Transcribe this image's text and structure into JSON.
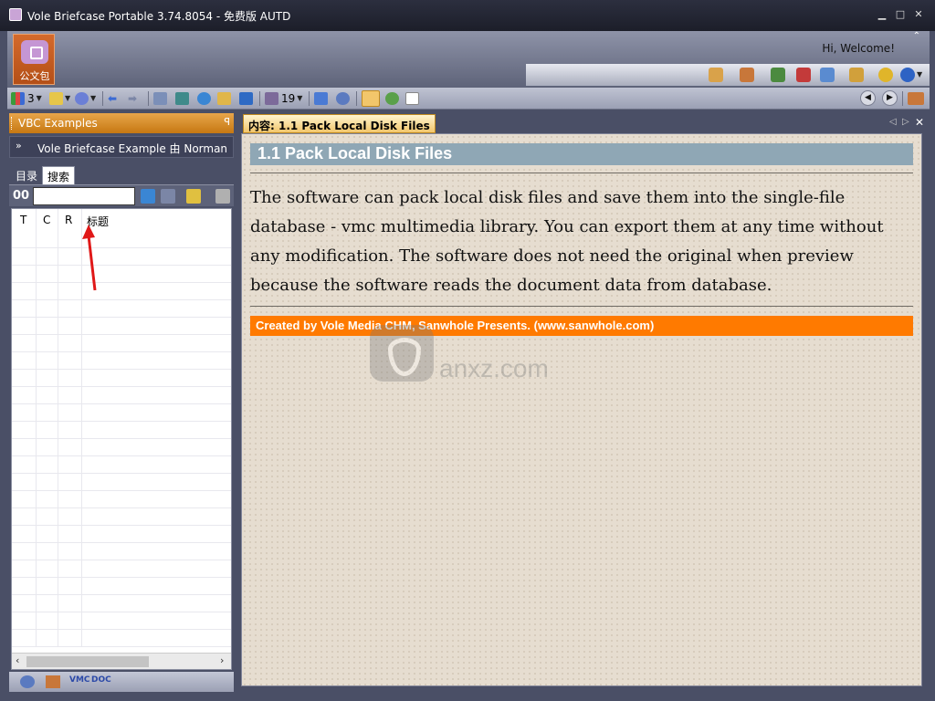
{
  "window": {
    "title": "Vole Briefcase Portable  3.74.8054 - 免费版 AUTD",
    "controls": [
      "minimize",
      "maximize",
      "close"
    ]
  },
  "header": {
    "logo_label": "公文包",
    "welcome_text": "Hi, Welcome!",
    "icons": [
      "palette-icon",
      "user-icon",
      "chart-icon",
      "calendar-64-icon",
      "checklist-icon",
      "tools-icon",
      "settings-icon",
      "help-icon"
    ]
  },
  "toolbar": {
    "view_count": "3",
    "page_count": "19"
  },
  "left_panel": {
    "title": "VBC Examples",
    "pin": "ꟼ",
    "book_title": "Vole Briefcase Example 由 Norman",
    "tabs": [
      {
        "label": "目录"
      },
      {
        "label": "搜索"
      }
    ],
    "search": {
      "prefix": "00",
      "value": ""
    },
    "columns": [
      "T",
      "C",
      "R",
      "标题"
    ],
    "bottom_labels": [
      "VMC",
      "DOC"
    ]
  },
  "content_panel": {
    "tab_label": "内容:  1.1 Pack Local Disk Files",
    "page_title": "1.1 Pack Local Disk Files",
    "body": "The software can pack local disk files and save them into the single-file database - vmc multimedia library. You can export them at any time without any modification. The software does not need the original when preview because the software reads the document data from database.",
    "footer": "Created by Vole Media CHM, Sanwhole Presents. (www.sanwhole.com)",
    "watermark": "anxz.com"
  },
  "colors": {
    "accent_orange": "#ff7a00",
    "title_bar_blue": "#8fa7b5",
    "panel_header": "#e8a54a",
    "frame": "#4a4f66"
  }
}
